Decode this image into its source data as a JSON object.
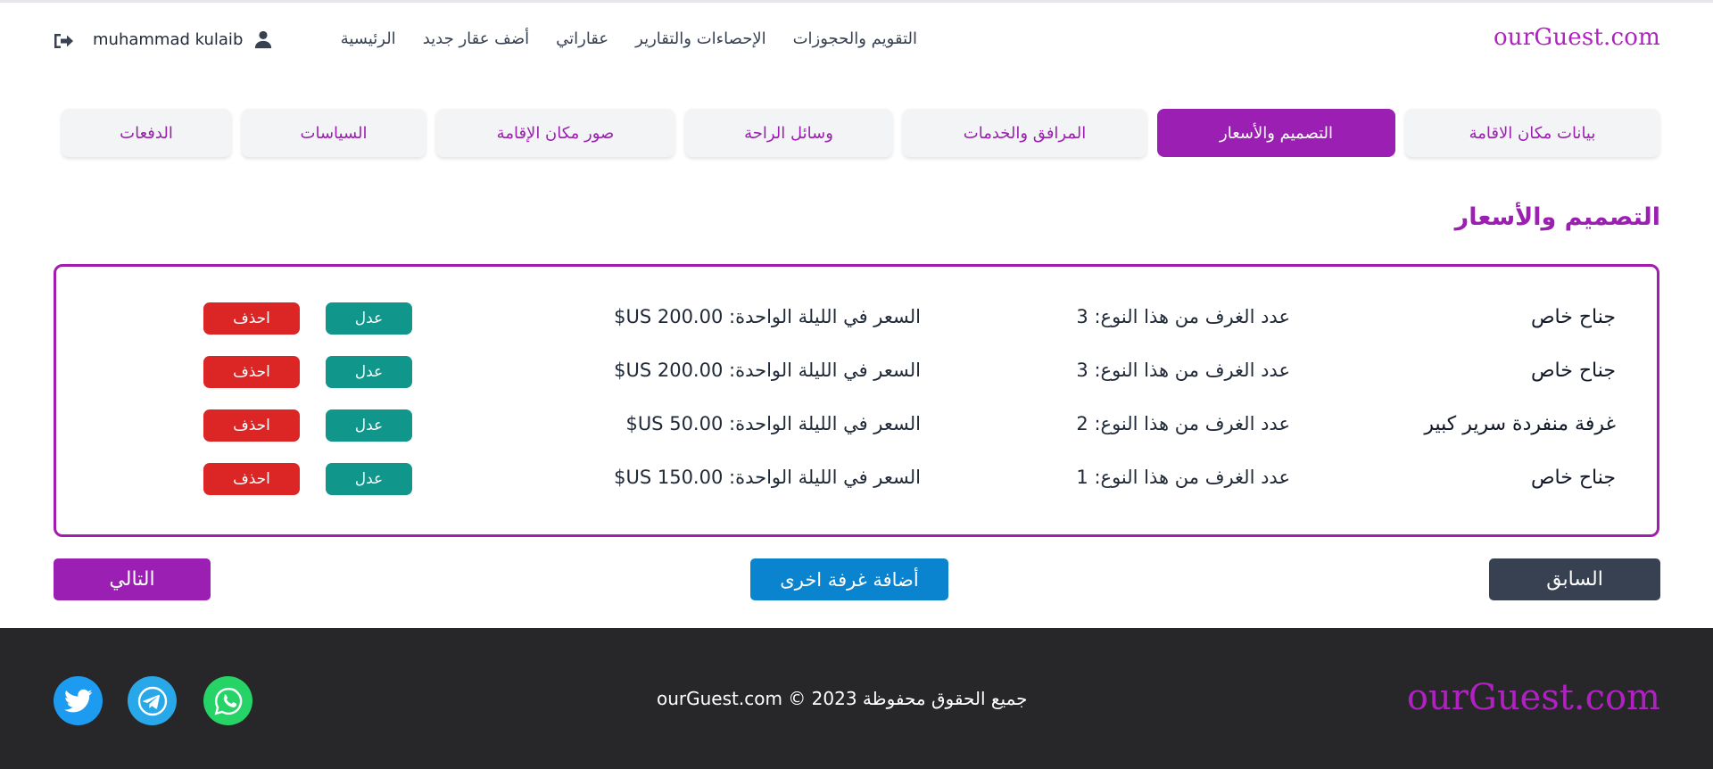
{
  "header": {
    "brand": "ourGuest.com",
    "nav": [
      "الرئيسية",
      "أضف عقار جديد",
      "عقاراتي",
      "الإحصاءات والتقارير",
      "التقويم والحجوزات"
    ],
    "user_name": "muhammad kulaib"
  },
  "tabs": [
    {
      "label": "بيانات مكان الاقامة",
      "active": false
    },
    {
      "label": "التصميم والأسعار",
      "active": true
    },
    {
      "label": "المرافق والخدمات",
      "active": false
    },
    {
      "label": "وسائل الراحة",
      "active": false
    },
    {
      "label": "صور مكان الإقامة",
      "active": false
    },
    {
      "label": "السياسات",
      "active": false
    },
    {
      "label": "الدفعات",
      "active": false
    }
  ],
  "section": {
    "title": "التصميم والأسعار"
  },
  "rooms": [
    {
      "name": "جناح خاص",
      "count": "عدد الغرف من هذا النوع: 3",
      "price": "السعر في الليلة الواحدة: 200.00 US$",
      "edit": "عدل",
      "delete": "احذف"
    },
    {
      "name": "جناح خاص",
      "count": "عدد الغرف من هذا النوع: 3",
      "price": "السعر في الليلة الواحدة: 200.00 US$",
      "edit": "عدل",
      "delete": "احذف"
    },
    {
      "name": "غرفة منفردة سرير كبير",
      "count": "عدد الغرف من هذا النوع: 2",
      "price": "السعر في الليلة الواحدة: 50.00 US$",
      "edit": "عدل",
      "delete": "احذف"
    },
    {
      "name": "جناح خاص",
      "count": "عدد الغرف من هذا النوع: 1",
      "price": "السعر في الليلة الواحدة: 150.00 US$",
      "edit": "عدل",
      "delete": "احذف"
    }
  ],
  "actions": {
    "prev": "السابق",
    "add_room": "أضافة غرفة اخرى",
    "next": "التالي"
  },
  "footer": {
    "brand": "ourGuest.com",
    "copyright": "جميع الحقوق محفوظة 2023 © ourGuest.com",
    "social": [
      "twitter-icon",
      "telegram-icon",
      "whatsapp-icon"
    ]
  },
  "colors": {
    "accent": "#9c1fb3",
    "edit": "#10968a",
    "delete": "#dc2626",
    "add": "#0b84cf",
    "prev": "#374151",
    "footer_bg": "#27272a"
  }
}
